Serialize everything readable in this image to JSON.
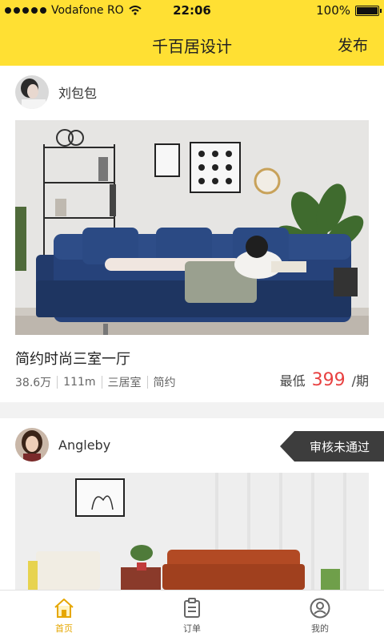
{
  "status_bar": {
    "carrier": "Vodafone RO",
    "time": "22:06",
    "battery": "100%"
  },
  "nav": {
    "title": "千百居设计",
    "action": "发布"
  },
  "posts": [
    {
      "author": "刘包包",
      "title": "简约时尚三室一厅",
      "tags": [
        "38.6万",
        "111m",
        "三居室",
        "简约"
      ],
      "price_prefix": "最低",
      "price_value": "399",
      "price_suffix": "/期"
    },
    {
      "author": "Angleby",
      "badge": "审核未通过"
    }
  ],
  "tabs": [
    {
      "label": "首页",
      "icon": "home-icon",
      "active": true
    },
    {
      "label": "订单",
      "icon": "order-icon",
      "active": false
    },
    {
      "label": "我的",
      "icon": "profile-icon",
      "active": false
    }
  ],
  "colors": {
    "accent": "#ffe033",
    "price": "#e84141",
    "tab_active": "#e6a700",
    "badge_bg": "#3d3d3d"
  }
}
